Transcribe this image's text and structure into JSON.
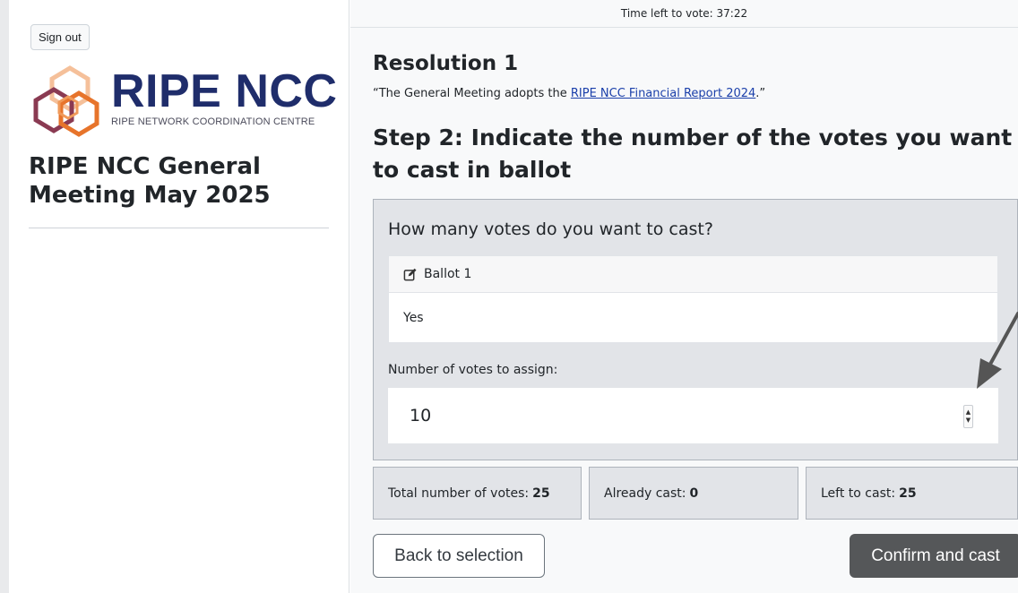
{
  "sidebar": {
    "sign_out_label": "Sign out",
    "logo": {
      "wordmark": "RIPE NCC",
      "subtitle": "RIPE NETWORK COORDINATION CENTRE"
    },
    "meeting_title": "RIPE NCC General Meeting May 2025"
  },
  "main": {
    "timer_text": "Time left to vote: 37:22",
    "resolution_title": "Resolution 1",
    "resolution_quote": {
      "prefix": "“The General Meeting adopts the ",
      "link_text": "RIPE NCC Financial Report 2024",
      "suffix": ".”"
    },
    "step_title": "Step 2: Indicate the number of the votes you want to cast in ballot",
    "panel": {
      "question": "How many votes do you want to cast?",
      "ballot_label": "Ballot 1",
      "ballot_icon": "edit-icon",
      "ballot_option": "Yes",
      "votes_label": "Number of votes to assign:",
      "votes_value": "10"
    },
    "stats": {
      "total_label": "Total number of votes:",
      "total_value": "25",
      "cast_label": "Already cast:",
      "cast_value": "0",
      "left_label": "Left to cast:",
      "left_value": "25"
    },
    "buttons": {
      "back": "Back to selection",
      "confirm": "Confirm and cast"
    }
  },
  "colors": {
    "brand_navy": "#1f2d6b",
    "panel_bg": "#e2e4e8",
    "confirm_button": "#555759",
    "link": "#1a3faa"
  }
}
